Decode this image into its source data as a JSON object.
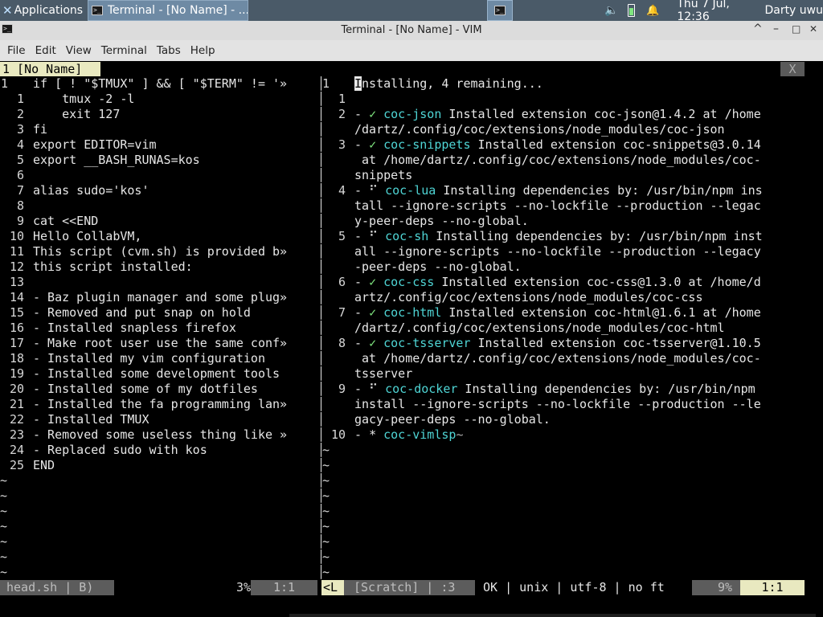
{
  "panel": {
    "apps_label": "Applications",
    "task_label": "Terminal - [No Name] - ...",
    "clock": "Thu  7 Jul, 12:36",
    "user": "Darty uwu"
  },
  "window": {
    "title": "Terminal - [No Name] - VIM",
    "min_glyph": "^",
    "minimize_glyph": "–",
    "maximize_glyph": "□",
    "close_glyph": "✕"
  },
  "menu": [
    "File",
    "Edit",
    "View",
    "Terminal",
    "Tabs",
    "Help"
  ],
  "vim": {
    "tab_label": "1 [No Name]",
    "tab_close": "X",
    "left_lines": [
      {
        "n": "1",
        "t": "if [ ! \"$TMUX\" ] && [ \"$TERM\" != '»"
      },
      {
        "n": "1",
        "t": "    tmux -2 -l"
      },
      {
        "n": "2",
        "t": "    exit 127"
      },
      {
        "n": "3",
        "t": "fi"
      },
      {
        "n": "4",
        "t": "export EDITOR=vim"
      },
      {
        "n": "5",
        "t": "export __BASH_RUNAS=kos"
      },
      {
        "n": "6",
        "t": ""
      },
      {
        "n": "7",
        "t": "alias sudo='kos'"
      },
      {
        "n": "8",
        "t": ""
      },
      {
        "n": "9",
        "t": "cat <<END"
      },
      {
        "n": "10",
        "t": "Hello CollabVM,"
      },
      {
        "n": "11",
        "t": "This script (cvm.sh) is provided b»"
      },
      {
        "n": "12",
        "t": "this script installed:"
      },
      {
        "n": "13",
        "t": ""
      },
      {
        "n": "14",
        "t": "- Baz plugin manager and some plug»"
      },
      {
        "n": "15",
        "t": "- Removed and put snap on hold"
      },
      {
        "n": "16",
        "t": "- Installed snapless firefox"
      },
      {
        "n": "17",
        "t": "- Make root user use the same conf»"
      },
      {
        "n": "18",
        "t": "- Installed my vim configuration"
      },
      {
        "n": "19",
        "t": "- Installed some development tools"
      },
      {
        "n": "20",
        "t": "- Installed some of my dotfiles"
      },
      {
        "n": "21",
        "t": "- Installed the fa programming lan»"
      },
      {
        "n": "22",
        "t": "- Installed TMUX"
      },
      {
        "n": "23",
        "t": "- Removed some useless thing like »"
      },
      {
        "n": "24",
        "t": "- Replaced sudo with kos"
      },
      {
        "n": "25",
        "t": "END"
      }
    ],
    "right": {
      "header": "nstalling, 4 remaining...",
      "cursor_char": "I",
      "items": [
        {
          "n": "2",
          "mark": "✓",
          "name": "coc-json",
          "lines": [
            " Installed extension coc-json@1.4.2 at /home",
            "/dartz/.config/coc/extensions/node_modules/coc-json"
          ]
        },
        {
          "n": "3",
          "mark": "✓",
          "name": "coc-snippets",
          "lines": [
            " Installed extension coc-snippets@3.0.14",
            " at /home/dartz/.config/coc/extensions/node_modules/coc-",
            "snippets"
          ]
        },
        {
          "n": "4",
          "mark": "⠋",
          "name": "coc-lua",
          "lines": [
            " Installing dependencies by: /usr/bin/npm ins",
            "tall --ignore-scripts --no-lockfile --production --legac",
            "y-peer-deps --no-global."
          ]
        },
        {
          "n": "5",
          "mark": "⠋",
          "name": "coc-sh",
          "lines": [
            " Installing dependencies by: /usr/bin/npm inst",
            "all --ignore-scripts --no-lockfile --production --legacy",
            "-peer-deps --no-global."
          ]
        },
        {
          "n": "6",
          "mark": "✓",
          "name": "coc-css",
          "lines": [
            " Installed extension coc-css@1.3.0 at /home/d",
            "artz/.config/coc/extensions/node_modules/coc-css"
          ]
        },
        {
          "n": "7",
          "mark": "✓",
          "name": "coc-html",
          "lines": [
            " Installed extension coc-html@1.6.1 at /home",
            "/dartz/.config/coc/extensions/node_modules/coc-html"
          ]
        },
        {
          "n": "8",
          "mark": "✓",
          "name": "coc-tsserver",
          "lines": [
            " Installed extension coc-tsserver@1.10.5",
            " at /home/dartz/.config/coc/extensions/node_modules/coc-",
            "tsserver"
          ]
        },
        {
          "n": "9",
          "mark": "⠋",
          "name": "coc-docker",
          "lines": [
            " Installing dependencies by: /usr/bin/npm",
            "install --ignore-scripts --no-lockfile --production --le",
            "gacy-peer-deps --no-global."
          ]
        },
        {
          "n": "10",
          "mark": "*",
          "name": "coc-vimlsp",
          "lines": [
            ""
          ]
        }
      ]
    },
    "status": {
      "left_file": "head.sh | B)",
      "left_percent": "3%",
      "left_pos": "1:1",
      "right_mode": "<L",
      "right_buf": "[Scratch] | :3",
      "right_info": "OK | unix | utf-8 | no ft",
      "right_percent": "9%",
      "right_pos": "1:1"
    },
    "tilde": "~"
  },
  "colors": {
    "panel_bg": "#4a5a68",
    "active_tab_bg": "#e9e9c0",
    "check_green": "#7fe57f",
    "name_cyan": "#4fd5d5"
  }
}
